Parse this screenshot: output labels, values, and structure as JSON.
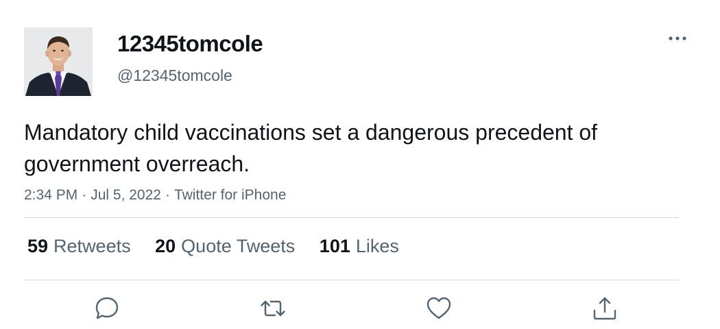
{
  "user": {
    "display_name": "12345tomcole",
    "handle": "@12345tomcole",
    "avatar_icon": "profile-photo"
  },
  "tweet": {
    "text": "Mandatory child vaccinations set a dangerous precedent of government overreach.",
    "time": "2:34 PM",
    "date": "Jul 5, 2022",
    "source": "Twitter for iPhone",
    "separator": "·"
  },
  "stats": {
    "retweets": {
      "count": "59",
      "label": "Retweets"
    },
    "quote_tweets": {
      "count": "20",
      "label": "Quote Tweets"
    },
    "likes": {
      "count": "101",
      "label": "Likes"
    }
  },
  "actions": {
    "reply_icon": "reply-icon",
    "retweet_icon": "retweet-icon",
    "like_icon": "heart-icon",
    "share_icon": "share-icon",
    "more_icon": "more-icon"
  },
  "colors": {
    "text_primary": "#0f1419",
    "text_secondary": "#536471",
    "divider": "#cfd9de"
  }
}
